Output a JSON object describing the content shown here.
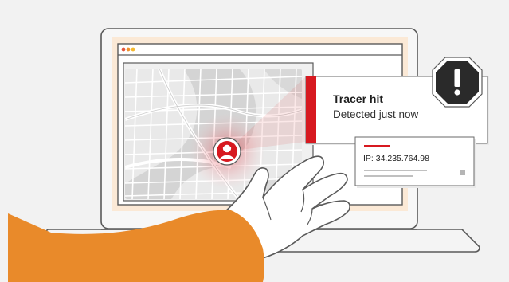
{
  "illustration": {
    "alert": {
      "title": "Tracer hit",
      "subtitle": "Detected just now",
      "icon": "exclamation-icon"
    },
    "ip_card": {
      "label": "IP: 34.235.764.98"
    },
    "map": {
      "marker_icon": "person-avatar-icon"
    },
    "browser": {
      "window_dots": [
        "red",
        "orange",
        "yellow"
      ]
    }
  },
  "colors": {
    "accent_red": "#d71920",
    "orange": "#e98a2a",
    "background": "#f2f2f2",
    "laptop_frame": "#f7f7f7",
    "outline": "#5a5a5a",
    "screen_panel": "#fbe9d6"
  }
}
